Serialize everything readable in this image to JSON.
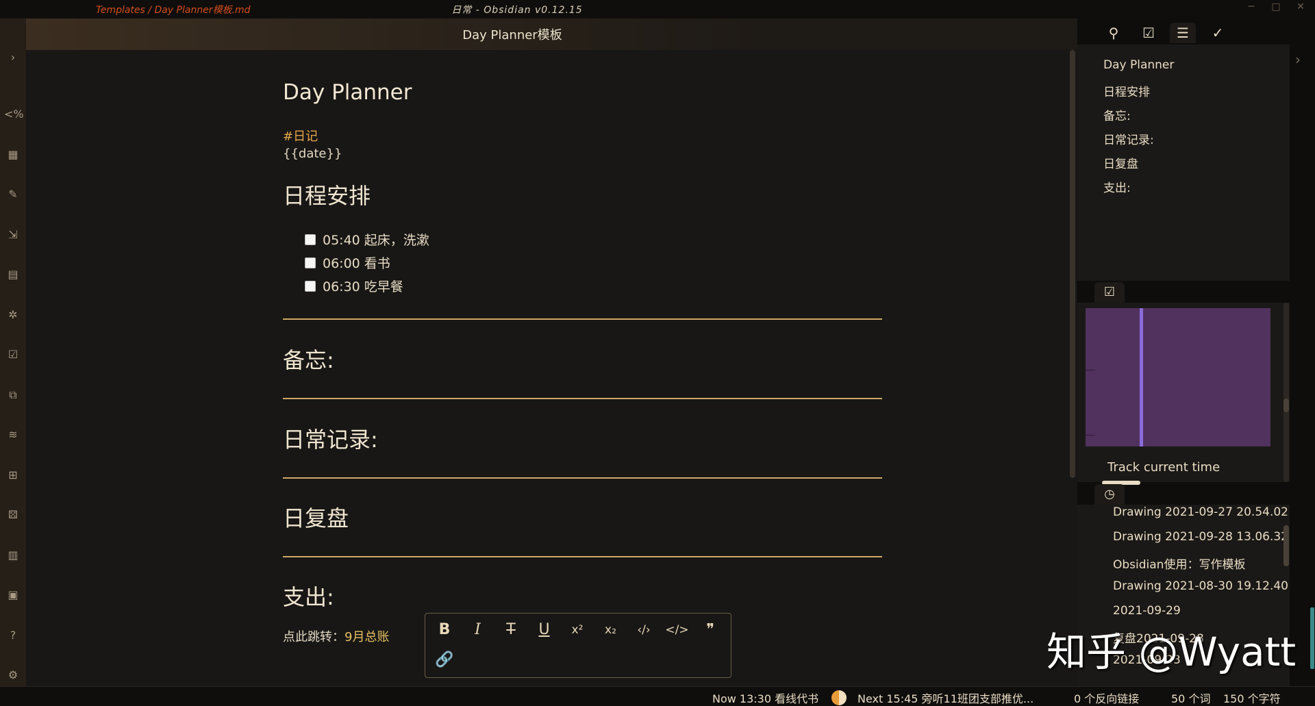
{
  "titlebar": {
    "path": "Templates / Day Planner模板.md",
    "window_title": "日常 - Obsidian v0.12.15",
    "minimize": "─",
    "maximize": "□",
    "close": "✕"
  },
  "left_ribbon": {
    "expand": "›",
    "items": [
      {
        "name": "templater-icon",
        "glyph": "<%"
      },
      {
        "name": "table-icon",
        "glyph": "▦"
      },
      {
        "name": "pen-icon",
        "glyph": "✎"
      },
      {
        "name": "open-arrow-icon",
        "glyph": "⇲"
      },
      {
        "name": "note-icon",
        "glyph": "▤"
      },
      {
        "name": "graph-icon",
        "glyph": "✲"
      },
      {
        "name": "calendar-check-icon",
        "glyph": "☑"
      },
      {
        "name": "copy-icon",
        "glyph": "⧉"
      },
      {
        "name": "stack-icon",
        "glyph": "≋"
      },
      {
        "name": "blocks-icon",
        "glyph": "⊞"
      },
      {
        "name": "dice-icon",
        "glyph": "⚄"
      },
      {
        "name": "kanban-icon",
        "glyph": "▥"
      },
      {
        "name": "image-icon",
        "glyph": "▣"
      },
      {
        "name": "help-icon",
        "glyph": "?"
      },
      {
        "name": "settings-icon",
        "glyph": "⚙"
      }
    ]
  },
  "editor": {
    "header_title": "Day Planner模板",
    "h1": "Day Planner",
    "tag": "#日记",
    "date_template": "{{date}}",
    "sections": {
      "schedule": "日程安排",
      "memo": "备忘:",
      "daily_log": "日常记录:",
      "review": "日复盘",
      "expense": "支出:"
    },
    "tasks": [
      "05:40 起床，洗漱",
      "06:00 看书",
      "06:30 吃早餐"
    ],
    "link_prefix": "点此跳转：",
    "link_text": "9月总账"
  },
  "format_toolbar": {
    "buttons": [
      {
        "name": "bold-button",
        "glyph": "B"
      },
      {
        "name": "italic-button",
        "glyph": "I"
      },
      {
        "name": "strikethrough-button",
        "glyph": "T"
      },
      {
        "name": "underline-button",
        "glyph": "U"
      },
      {
        "name": "superscript-button",
        "glyph": "x²"
      },
      {
        "name": "subscript-button",
        "glyph": "x₂"
      },
      {
        "name": "inline-code-button",
        "glyph": "‹/›"
      },
      {
        "name": "code-block-button",
        "glyph": "</>"
      },
      {
        "name": "quote-button",
        "glyph": "❞"
      },
      {
        "name": "link-button",
        "glyph": "🔗"
      }
    ]
  },
  "right_pane": {
    "tabs": [
      {
        "name": "tab-tag-search",
        "glyph": "⚲"
      },
      {
        "name": "tab-calendar",
        "glyph": "☑"
      },
      {
        "name": "tab-outline",
        "glyph": "☰"
      },
      {
        "name": "tab-tasks",
        "glyph": "✓"
      }
    ],
    "outline": [
      "Day Planner",
      "日程安排",
      "备忘:",
      "日常记录:",
      "日复盘",
      "支出:"
    ],
    "calendar_tab": "☑",
    "track_current_time": "Track current time",
    "recent_tab": "◷",
    "recent_files": [
      "Drawing 2021-09-27 20.54.02",
      "Drawing 2021-09-28 13.06.32",
      "Obsidian使用：写作模板",
      "Drawing 2021-08-30 19.12.40",
      "2021-09-29",
      "复盘2021-09-28",
      "2021-09-23"
    ],
    "collapse": "›"
  },
  "watermark": "知乎 @Wyatt",
  "statusbar": {
    "now": "Now 13:30 看线代书",
    "next": "Next 15:45 旁听11班团支部推优...",
    "backlinks": "0 个反向链接",
    "words": "50 个词",
    "chars": "150 个字符"
  }
}
